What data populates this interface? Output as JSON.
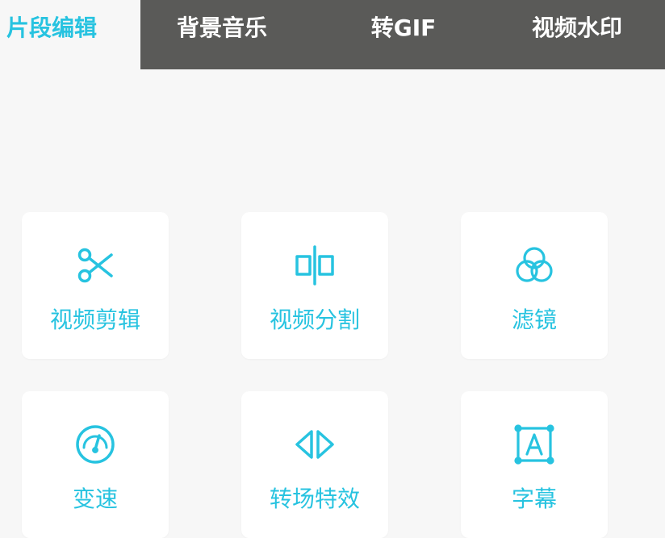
{
  "tabs": [
    {
      "label": "片段编辑",
      "active": true
    },
    {
      "label": "背景音乐",
      "active": false
    },
    {
      "label": "转GIF",
      "active": false
    },
    {
      "label": "视频水印",
      "active": false
    }
  ],
  "tools": [
    {
      "label": "视频剪辑",
      "icon": "scissors-icon"
    },
    {
      "label": "视频分割",
      "icon": "split-icon"
    },
    {
      "label": "滤镜",
      "icon": "filter-circles-icon"
    },
    {
      "label": "变速",
      "icon": "speedometer-icon"
    },
    {
      "label": "转场特效",
      "icon": "transition-arrows-icon"
    },
    {
      "label": "字幕",
      "icon": "text-box-icon"
    }
  ],
  "colors": {
    "accent": "#27c3e0",
    "tabbar": "#5a5a58",
    "background": "#f7f7f7",
    "card": "#ffffff"
  }
}
